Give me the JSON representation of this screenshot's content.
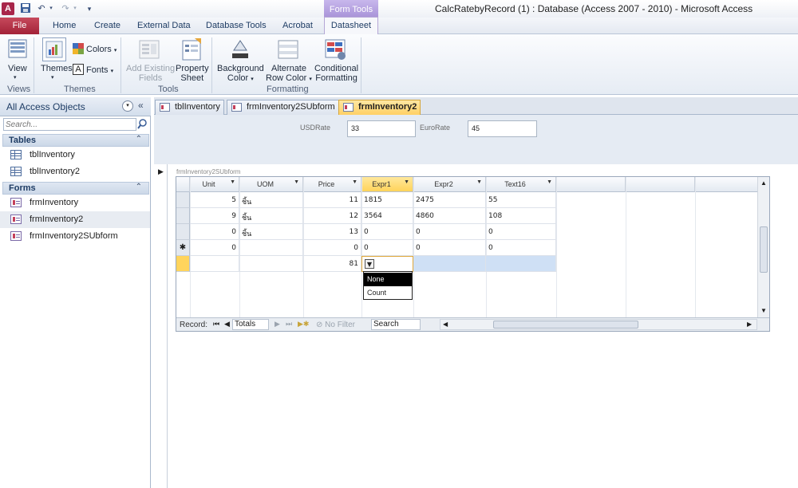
{
  "window": {
    "title": "CalcRatebyRecord (1) : Database (Access 2007 - 2010)  -  Microsoft Access"
  },
  "quick_access": {
    "logo": "A"
  },
  "ribbon_tabs": {
    "file": "File",
    "home": "Home",
    "create": "Create",
    "external": "External Data",
    "dbtools": "Database Tools",
    "acrobat": "Acrobat",
    "contextual_header": "Form Tools",
    "datasheet": "Datasheet"
  },
  "ribbon": {
    "view": "View",
    "themes": "Themes",
    "colors": "Colors",
    "fonts": "Fonts",
    "add_existing": "Add Existing",
    "fields": "Fields",
    "property": "Property",
    "sheet": "Sheet",
    "background": "Background",
    "color": "Color",
    "alternate": "Alternate",
    "row_color": "Row Color",
    "conditional": "Conditional",
    "formatting": "Formatting",
    "groups": {
      "views": "Views",
      "themes": "Themes",
      "tools": "Tools",
      "formatting": "Formatting"
    }
  },
  "nav": {
    "title": "All Access Objects",
    "search_placeholder": "Search...",
    "groups": [
      {
        "label": "Tables",
        "items": [
          "tblInventory",
          "tblInventory2"
        ]
      },
      {
        "label": "Forms",
        "items": [
          "frmInventory",
          "frmInventory2",
          "frmInventory2SUbform"
        ]
      }
    ]
  },
  "doc_tabs": [
    "tblInventory",
    "frmInventory2SUbform",
    "frmInventory2"
  ],
  "form": {
    "usd_label": "USDRate",
    "usd_value": "33",
    "euro_label": "EuroRate",
    "euro_value": "45",
    "subform_label": "frmInventory2SUbform"
  },
  "grid": {
    "columns": [
      "Unit",
      "UOM",
      "Price",
      "Expr1",
      "Expr2",
      "Text16"
    ],
    "rows": [
      [
        "5",
        "ชิ้น",
        "11",
        "1815",
        "2475",
        "55"
      ],
      [
        "9",
        "ชิ้น",
        "12",
        "3564",
        "4860",
        "108"
      ],
      [
        "0",
        "ชิ้น",
        "13",
        "0",
        "0",
        "0"
      ],
      [
        "0",
        "",
        "0",
        "0",
        "0",
        "0"
      ]
    ],
    "new_row_marker": "✱",
    "totals_row_price": "81",
    "dropdown_options": [
      "None",
      "Count"
    ]
  },
  "record_nav": {
    "label": "Record:",
    "current": "Totals",
    "filter": "No Filter",
    "search": "Search"
  }
}
